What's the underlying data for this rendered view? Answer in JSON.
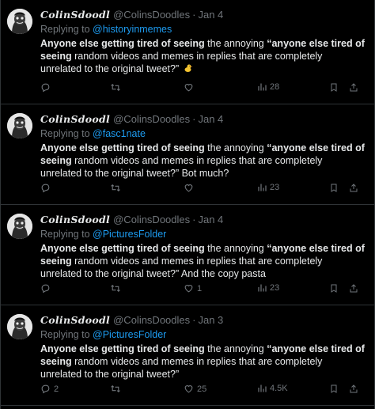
{
  "tweets": [
    {
      "author_name": "ColinSdoodl",
      "author_handle": "@ColinsDoodles",
      "separator": "·",
      "date": "Jan 4",
      "replying_label": "Replying to",
      "replying_to": "@historyinmemes",
      "text_bold_1": "Anyone else getting tired of seeing",
      "text_plain_1": " the  annoying ",
      "text_bold_2": "“anyone else tired of seeing",
      "text_plain_2": " random videos and memes in replies that are completely unrelated to the original tweet?” ",
      "emoji": "duck-emoji",
      "counts": {
        "reply": "",
        "retweet": "",
        "like": "",
        "views": "28"
      }
    },
    {
      "author_name": "ColinSdoodl",
      "author_handle": "@ColinsDoodles",
      "separator": "·",
      "date": "Jan 4",
      "replying_label": "Replying to",
      "replying_to": "@fasc1nate",
      "text_bold_1": "Anyone else getting tired of seeing",
      "text_plain_1": " the  annoying ",
      "text_bold_2": "“anyone else tired of seeing",
      "text_plain_2": " random videos and memes in replies that are completely unrelated to the original tweet?” Bot much?",
      "counts": {
        "reply": "",
        "retweet": "",
        "like": "",
        "views": "23"
      }
    },
    {
      "author_name": "ColinSdoodl",
      "author_handle": "@ColinsDoodles",
      "separator": "·",
      "date": "Jan 4",
      "replying_label": "Replying to",
      "replying_to": "@PicturesFolder",
      "text_bold_1": "Anyone else getting tired of seeing",
      "text_plain_1": " the  annoying ",
      "text_bold_2": "“anyone else tired of seeing",
      "text_plain_2": " random videos and memes in replies that are completely unrelated to the original tweet?” And the copy pasta",
      "counts": {
        "reply": "",
        "retweet": "",
        "like": "1",
        "views": "23"
      }
    },
    {
      "author_name": "ColinSdoodl",
      "author_handle": "@ColinsDoodles",
      "separator": "·",
      "date": "Jan 3",
      "replying_label": "Replying to",
      "replying_to": "@PicturesFolder",
      "text_bold_1": "Anyone else getting tired of seeing",
      "text_plain_1": " the  annoying ",
      "text_bold_2": "“anyone else tired of seeing",
      "text_plain_2": " random videos and memes in replies that are completely unrelated to the original tweet?”",
      "counts": {
        "reply": "2",
        "retweet": "",
        "like": "25",
        "views": "4.5K"
      }
    }
  ],
  "icons": {
    "reply": "reply-icon",
    "retweet": "retweet-icon",
    "like": "like-icon",
    "views": "views-icon",
    "bookmark": "bookmark-icon",
    "share": "share-icon"
  },
  "colors": {
    "background": "#000000",
    "text": "#e7e9ea",
    "muted": "#71767b",
    "link": "#1d9bf0",
    "divider": "#2f3336"
  }
}
